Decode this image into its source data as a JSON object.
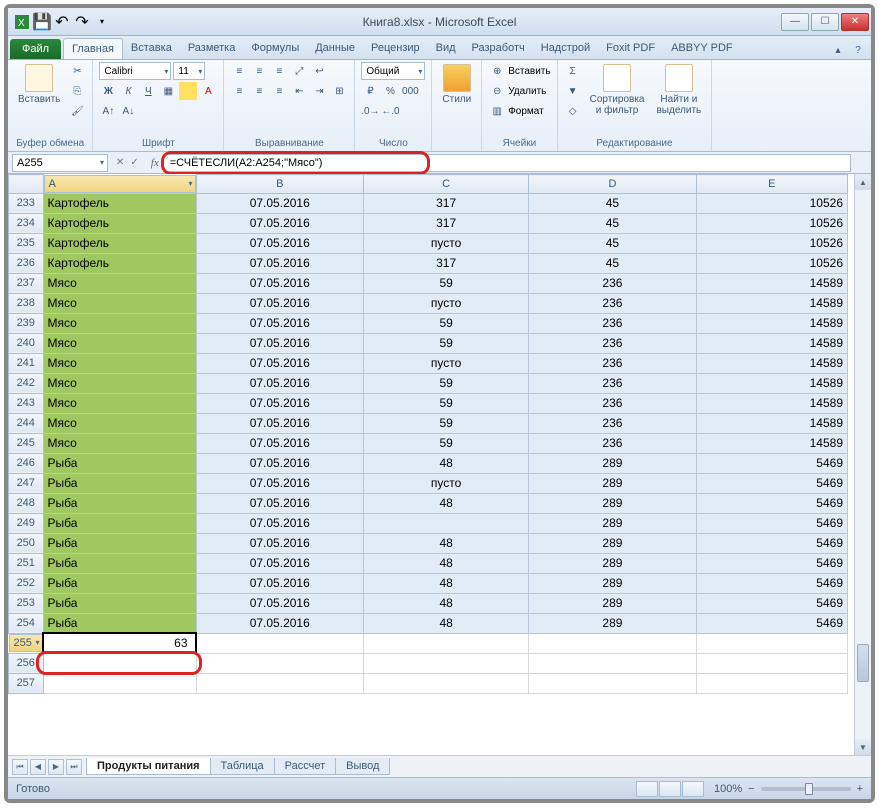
{
  "window": {
    "title": "Книга8.xlsx - Microsoft Excel"
  },
  "ribbon": {
    "file": "Файл",
    "tabs": [
      "Главная",
      "Вставка",
      "Разметка",
      "Формулы",
      "Данные",
      "Рецензир",
      "Вид",
      "Разработч",
      "Надстрой",
      "Foxit PDF",
      "ABBYY PDF"
    ],
    "active_tab": 0,
    "groups": {
      "clipboard": {
        "paste": "Вставить",
        "label": "Буфер обмена"
      },
      "font": {
        "name": "Calibri",
        "size": "11",
        "label": "Шрифт"
      },
      "align": {
        "label": "Выравнивание"
      },
      "number": {
        "format": "Общий",
        "label": "Число"
      },
      "styles": {
        "btn": "Стили",
        "label": ""
      },
      "cells": {
        "insert": "Вставить",
        "delete": "Удалить",
        "format": "Формат",
        "label": "Ячейки"
      },
      "editing": {
        "sort": "Сортировка\nи фильтр",
        "find": "Найти и\nвыделить",
        "label": "Редактирование"
      }
    }
  },
  "formula_bar": {
    "name_box": "A255",
    "formula": "=СЧЁТЕСЛИ(A2:A254;\"Мясо\")"
  },
  "columns": [
    "A",
    "B",
    "C",
    "D",
    "E"
  ],
  "rows": [
    {
      "n": 233,
      "a": "Картофель",
      "b": "07.05.2016",
      "c": "317",
      "d": "45",
      "e": "10526"
    },
    {
      "n": 234,
      "a": "Картофель",
      "b": "07.05.2016",
      "c": "317",
      "d": "45",
      "e": "10526"
    },
    {
      "n": 235,
      "a": "Картофель",
      "b": "07.05.2016",
      "c": "пусто",
      "d": "45",
      "e": "10526"
    },
    {
      "n": 236,
      "a": "Картофель",
      "b": "07.05.2016",
      "c": "317",
      "d": "45",
      "e": "10526"
    },
    {
      "n": 237,
      "a": "Мясо",
      "b": "07.05.2016",
      "c": "59",
      "d": "236",
      "e": "14589"
    },
    {
      "n": 238,
      "a": "Мясо",
      "b": "07.05.2016",
      "c": "пусто",
      "d": "236",
      "e": "14589"
    },
    {
      "n": 239,
      "a": "Мясо",
      "b": "07.05.2016",
      "c": "59",
      "d": "236",
      "e": "14589"
    },
    {
      "n": 240,
      "a": "Мясо",
      "b": "07.05.2016",
      "c": "59",
      "d": "236",
      "e": "14589"
    },
    {
      "n": 241,
      "a": "Мясо",
      "b": "07.05.2016",
      "c": "пусто",
      "d": "236",
      "e": "14589"
    },
    {
      "n": 242,
      "a": "Мясо",
      "b": "07.05.2016",
      "c": "59",
      "d": "236",
      "e": "14589"
    },
    {
      "n": 243,
      "a": "Мясо",
      "b": "07.05.2016",
      "c": "59",
      "d": "236",
      "e": "14589"
    },
    {
      "n": 244,
      "a": "Мясо",
      "b": "07.05.2016",
      "c": "59",
      "d": "236",
      "e": "14589"
    },
    {
      "n": 245,
      "a": "Мясо",
      "b": "07.05.2016",
      "c": "59",
      "d": "236",
      "e": "14589"
    },
    {
      "n": 246,
      "a": "Рыба",
      "b": "07.05.2016",
      "c": "48",
      "d": "289",
      "e": "5469"
    },
    {
      "n": 247,
      "a": "Рыба",
      "b": "07.05.2016",
      "c": "пусто",
      "d": "289",
      "e": "5469"
    },
    {
      "n": 248,
      "a": "Рыба",
      "b": "07.05.2016",
      "c": "48",
      "d": "289",
      "e": "5469"
    },
    {
      "n": 249,
      "a": "Рыба",
      "b": "07.05.2016",
      "c": "",
      "d": "289",
      "e": "5469"
    },
    {
      "n": 250,
      "a": "Рыба",
      "b": "07.05.2016",
      "c": "48",
      "d": "289",
      "e": "5469"
    },
    {
      "n": 251,
      "a": "Рыба",
      "b": "07.05.2016",
      "c": "48",
      "d": "289",
      "e": "5469"
    },
    {
      "n": 252,
      "a": "Рыба",
      "b": "07.05.2016",
      "c": "48",
      "d": "289",
      "e": "5469"
    },
    {
      "n": 253,
      "a": "Рыба",
      "b": "07.05.2016",
      "c": "48",
      "d": "289",
      "e": "5469"
    },
    {
      "n": 254,
      "a": "Рыба",
      "b": "07.05.2016",
      "c": "48",
      "d": "289",
      "e": "5469"
    }
  ],
  "result_row": {
    "n": 255,
    "value": "63"
  },
  "empty_rows": [
    256,
    257
  ],
  "sheets": {
    "active": "Продукты питания",
    "others": [
      "Таблица",
      "Рассчет",
      "Вывод"
    ]
  },
  "status": {
    "ready": "Готово",
    "zoom": "100%"
  }
}
